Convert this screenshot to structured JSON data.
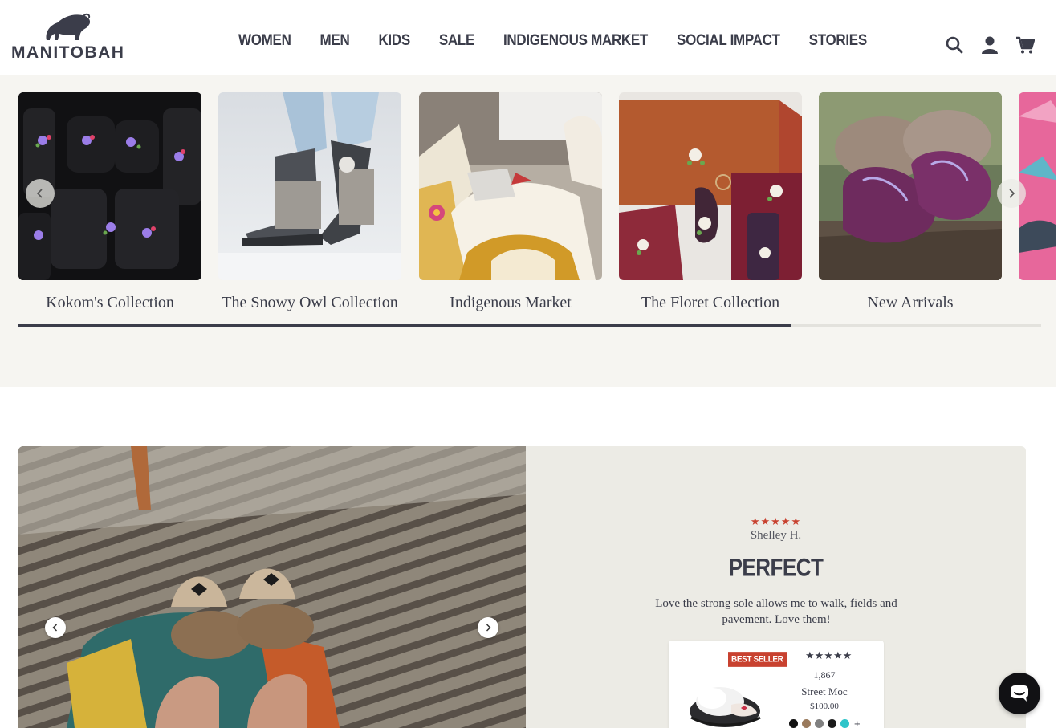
{
  "brand": {
    "name": "MANITOBAH"
  },
  "nav": {
    "items": [
      "WOMEN",
      "MEN",
      "KIDS",
      "SALE",
      "INDIGENOUS MARKET",
      "SOCIAL IMPACT",
      "STORIES"
    ]
  },
  "header_icons": [
    "search-icon",
    "account-icon",
    "cart-icon"
  ],
  "collections": {
    "cards": [
      {
        "label": "Kokom's Collection"
      },
      {
        "label": "The Snowy Owl Collection"
      },
      {
        "label": "Indigenous Market"
      },
      {
        "label": "The Floret Collection"
      },
      {
        "label": "New Arrivals"
      }
    ],
    "scroll_progress": 0.755
  },
  "review": {
    "rating_stars": "★★★★★",
    "reviewer": "Shelley H.",
    "title": "PERFECT",
    "body": "Love the strong sole allows me to walk, fields and pavement. Love them!",
    "product": {
      "badge": "BEST SELLER",
      "rating_stars": "★★★★★",
      "review_count": "1,867",
      "name": "Street Moc",
      "price": "$100.00",
      "swatches": [
        "#111111",
        "#9a7a5c",
        "#808080",
        "#1a1a1a",
        "#2ec4c9"
      ],
      "more_label": "+"
    }
  },
  "colors": {
    "accent": "#c8412f",
    "ink": "#3b3d4a",
    "band_bg": "#f6f5f1",
    "panel_bg": "#ecebe5"
  }
}
